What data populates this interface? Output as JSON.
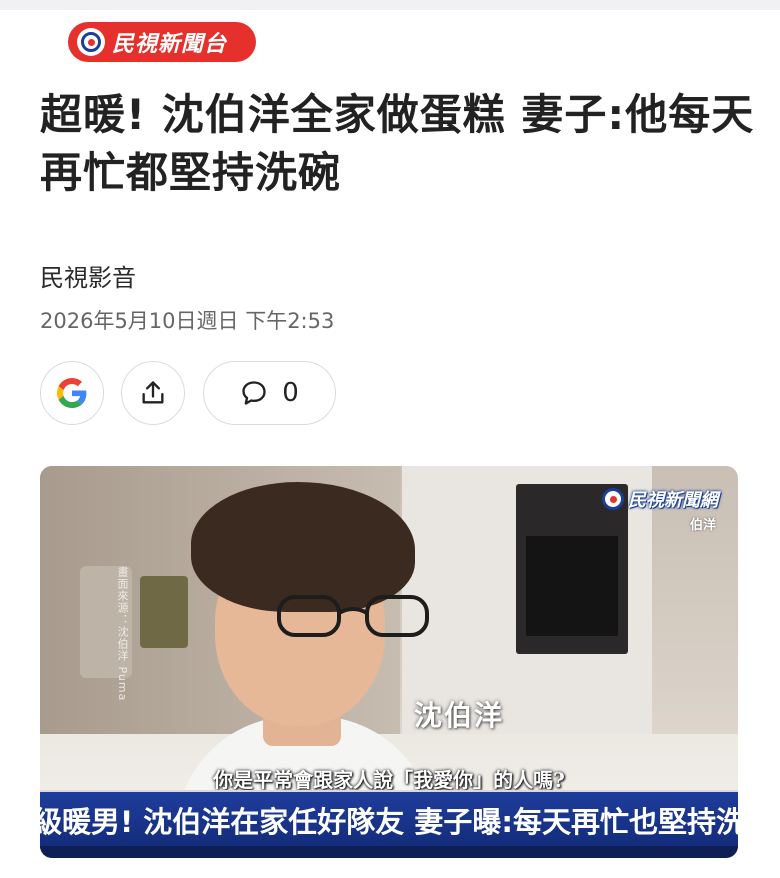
{
  "publisher": {
    "logo_text": "民視新聞台",
    "brand_color": "#e6302b"
  },
  "article": {
    "headline": "超暖! 沈伯洋全家做蛋糕 妻子:他每天再忙都堅持洗碗",
    "source": "民視影音",
    "timestamp": "2026年5月10日週日 下午2:53"
  },
  "actions": {
    "google_icon": "google-icon",
    "share_icon": "share-icon",
    "comment_icon": "comment-bubble-icon",
    "comment_count": "0"
  },
  "video": {
    "watermark": "民視新聞網",
    "watermark_sub": "伯洋",
    "side_credit": "畫面來源：沈伯洋 Puma",
    "speaker_name": "沈伯洋",
    "subtitle": "你是平常會跟家人說「我愛你」的人嗎?",
    "banner": "超級暖男! 沈伯洋在家任好隊友 妻子曝:每天再忙也堅持洗碗",
    "banner_color": "#1f3d9c"
  }
}
